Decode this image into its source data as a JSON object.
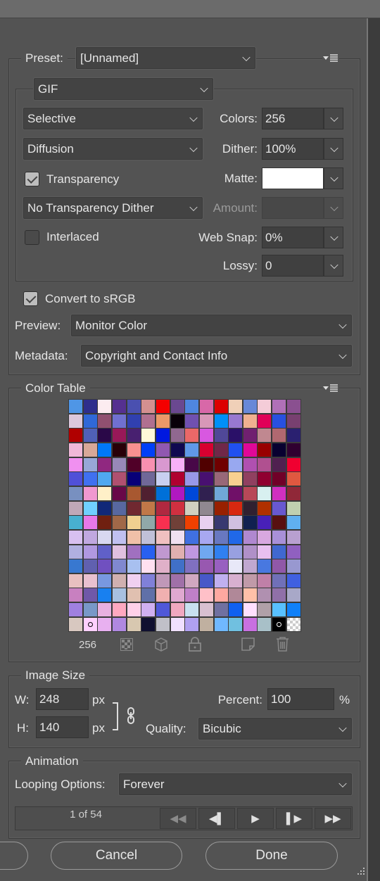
{
  "preset": {
    "label": "Preset:",
    "value": "[Unnamed]"
  },
  "format": {
    "value": "GIF"
  },
  "reduction": {
    "value": "Selective"
  },
  "colors": {
    "label": "Colors:",
    "value": "256"
  },
  "dither_algo": {
    "value": "Diffusion"
  },
  "dither": {
    "label": "Dither:",
    "value": "100%"
  },
  "transparency": {
    "label": "Transparency",
    "checked": true
  },
  "matte": {
    "label": "Matte:",
    "color": "#ffffff"
  },
  "transparency_dither": {
    "value": "No Transparency Dither"
  },
  "amount": {
    "label": "Amount:",
    "value": "",
    "disabled": true
  },
  "interlaced": {
    "label": "Interlaced",
    "checked": false
  },
  "web_snap": {
    "label": "Web Snap:",
    "value": "0%"
  },
  "lossy": {
    "label": "Lossy:",
    "value": "0"
  },
  "convert_srgb": {
    "label": "Convert to sRGB",
    "checked": true
  },
  "preview": {
    "label": "Preview:",
    "value": "Monitor Color"
  },
  "metadata": {
    "label": "Metadata:",
    "value": "Copyright and Contact Info"
  },
  "color_table": {
    "title": "Color Table",
    "count": "256",
    "colors": [
      "#4f96e6",
      "#2e2e8c",
      "#fcecf0",
      "#553090",
      "#4a50b0",
      "#d49090",
      "#f40000",
      "#6a4890",
      "#4f86e0",
      "#d868a8",
      "#dc0000",
      "#f0d0b8",
      "#6888d8",
      "#f4ccd8",
      "#b070b8",
      "#8a5090",
      "#dcc8dc",
      "#3068d8",
      "#905070",
      "#7070d0",
      "#3040b0",
      "#b07090",
      "#ec9868",
      "#080008",
      "#7050b0",
      "#d898b8",
      "#0090f8",
      "#9878d0",
      "#f0b090",
      "#e00058",
      "#2850e0",
      "#784070",
      "#b00000",
      "#5060b8",
      "#2a0848",
      "#981858",
      "#482070",
      "#fff8d8",
      "#0018e0",
      "#906890",
      "#ea6868",
      "#d858e0",
      "#504898",
      "#2a1068",
      "#702070",
      "#c08890",
      "#b06870",
      "#2a2070",
      "#f0b8d8",
      "#d8a898",
      "#0078f8",
      "#280008",
      "#f89090",
      "#0040f8",
      "#9058b0",
      "#100850",
      "#6098e8",
      "#d80030",
      "#702848",
      "#2050f0",
      "#e00898",
      "#980000",
      "#080030",
      "#300030",
      "#f090f0",
      "#98a8d8",
      "#902880",
      "#9888b8",
      "#500028",
      "#f890b0",
      "#d898d0",
      "#f8b0f8",
      "#480848",
      "#500000",
      "#700000",
      "#98a8f0",
      "#b050b0",
      "#b05090",
      "#502050",
      "#f00030",
      "#5050d8",
      "#4070f0",
      "#50a8f0",
      "#b05070",
      "#080078",
      "#706898",
      "#c8d0f0",
      "#b00030",
      "#9898e8",
      "#481070",
      "#986878",
      "#f8d090",
      "#904060",
      "#900030",
      "#700028",
      "#e05840",
      "#7890c0",
      "#f098d0",
      "#fff0c8",
      "#680848",
      "#a85830",
      "#502030",
      "#0070d8",
      "#b018c0",
      "#0048d8",
      "#302050",
      "#70a8d8",
      "#701068",
      "#b84858",
      "#d8f0f0",
      "#d030c0",
      "#902838",
      "#c0a8b8",
      "#70d0ff",
      "#102878",
      "#5868a0",
      "#702830",
      "#c07848",
      "#b02840",
      "#d03040",
      "#d0d0c0",
      "#908890",
      "#982000",
      "#d82810",
      "#302030",
      "#b03000",
      "#6858d0",
      "#c0d0b0",
      "#48b0d0",
      "#e878e8",
      "#702010",
      "#a06848",
      "#f0d090",
      "#90a8a8",
      "#f83050",
      "#704038",
      "#f04000",
      "#e8d0f0",
      "#383870",
      "#d0c0e0",
      "#102050",
      "#4820b8",
      "#581010",
      "#60b0f0",
      "#d8c0f0",
      "#c0a8e0",
      "#d8d8f0",
      "#c0c0f0",
      "#f0c0a8",
      "#c0c0d8",
      "#f0c0c0",
      "#f0e0f0",
      "#4070e0",
      "#a8a8f0",
      "#6878c0",
      "#2068e8",
      "#b088d0",
      "#d8a8e0",
      "#a890d8",
      "#b8a0d0",
      "#b0b0e0",
      "#b098e0",
      "#6060c8",
      "#e0c0e0",
      "#a070c0",
      "#2860f0",
      "#c098d0",
      "#e0b0b0",
      "#c098e0",
      "#70a8f0",
      "#3080f0",
      "#98a0e0",
      "#b090c8",
      "#e8c0f0",
      "#4068d0",
      "#9060c0",
      "#3878d0",
      "#6060b0",
      "#7050c0",
      "#8088d0",
      "#a8c0f0",
      "#ffe0f0",
      "#e0b0c8",
      "#4070c8",
      "#8070c0",
      "#9858b0",
      "#9860c0",
      "#e8e8f8",
      "#c0a8d0",
      "#4878e0",
      "#9058a8",
      "#9898d0",
      "#e8c0c0",
      "#e8c0d0",
      "#7898e0",
      "#d0b0b0",
      "#f0d0f0",
      "#8080d8",
      "#c098b8",
      "#a070a8",
      "#d0a8c0",
      "#4858c8",
      "#c0b0f0",
      "#d8b0d0",
      "#c09aa8",
      "#c080a8",
      "#7070b8",
      "#4060e0",
      "#c880c0",
      "#7058a8",
      "#1880f0",
      "#a8c0e0",
      "#e0c0b0",
      "#6070a8",
      "#f0b0b0",
      "#e0a8d0",
      "#c080c8",
      "#ffc0c8",
      "#ffa8a0",
      "#b08898",
      "#ffc0a8",
      "#b090b0",
      "#9070a8",
      "#a8a8c8",
      "#a080e0",
      "#7898c8",
      "#e8b0e0",
      "#ffa8c0",
      "#ffd0e8",
      "#d0b0f0",
      "#5058d8",
      "#f0a8c0",
      "#c8e0f0",
      "#d8c0d0",
      "#7070a0",
      "#1060f0",
      "#ffe0ff",
      "#b0a0a8",
      "#58c0ff",
      "#1080f8",
      "#d8c8c0",
      "#ffd0ff",
      "#e8b0f0",
      "#b088e0",
      "#d8c8b0",
      "#101030",
      "#c0c0c8",
      "#f0e0ff",
      "#b0a0f0",
      "#c0b0a0",
      "#70b8ff",
      "#70c0e0",
      "#c870e0",
      "#a8c0c8",
      "#000000",
      "transparent"
    ]
  },
  "image_size": {
    "title": "Image Size",
    "w_label": "W:",
    "w_value": "248",
    "h_label": "H:",
    "h_value": "140",
    "unit": "px",
    "percent_label": "Percent:",
    "percent_value": "100",
    "percent_unit": "%",
    "quality_label": "Quality:",
    "quality_value": "Bicubic"
  },
  "animation": {
    "title": "Animation",
    "looping_label": "Looping Options:",
    "looping_value": "Forever",
    "frame_counter": "1 of 54",
    "controls": [
      "◀◀",
      "◀▌",
      "▶",
      "▌▶",
      "▶▶"
    ]
  },
  "footer": {
    "cancel": "Cancel",
    "done": "Done"
  }
}
